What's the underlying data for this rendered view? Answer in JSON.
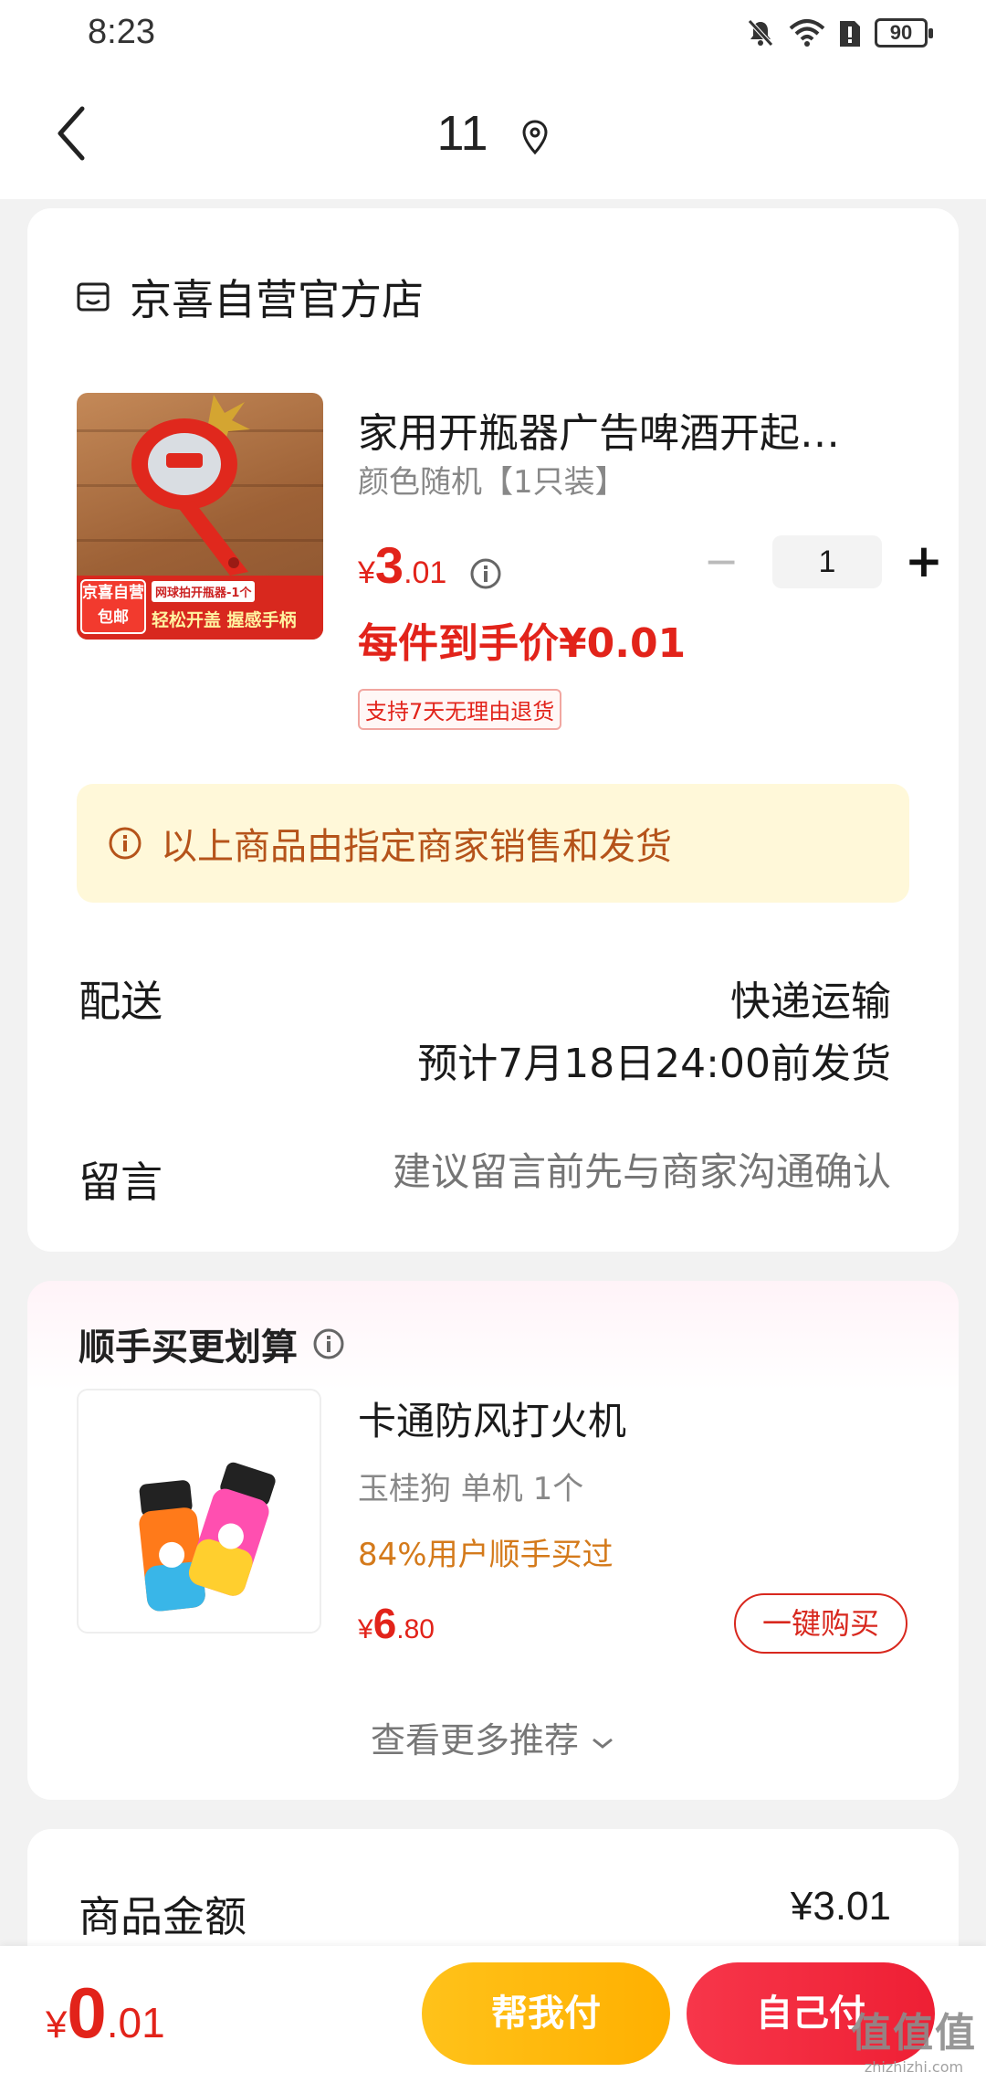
{
  "status_bar": {
    "time": "8:23",
    "battery": "90"
  },
  "nav": {
    "title": "11"
  },
  "shop": {
    "name": "京喜自营官方店"
  },
  "product": {
    "title": "家用开瓶器广告啤酒开起…",
    "spec": "颜色随机【1只装】",
    "price_currency": "¥",
    "price_int": "3",
    "price_dec": ".01",
    "quantity": "1",
    "final_price": "每件到手价¥0.01",
    "return_tag": "支持7天无理由退货",
    "image": {
      "badge": "京喜自营\n包邮",
      "label_small": "网球拍开瓶器-1个",
      "tag": "轻松开盖 握感手柄"
    }
  },
  "notice": {
    "text": "以上商品由指定商家销售和发货"
  },
  "delivery": {
    "label": "配送",
    "method": "快递运输",
    "eta": "预计7月18日24:00前发货"
  },
  "message": {
    "label": "留言",
    "placeholder": "建议留言前先与商家沟通确认"
  },
  "recommend": {
    "section_title": "顺手买更划算",
    "item": {
      "title": "卡通防风打火机",
      "spec": "玉桂狗 单机 1个",
      "tip": "84%用户顺手买过",
      "price_currency": "¥",
      "price_int": "6",
      "price_dec": ".80",
      "buy_label": "一键购买"
    },
    "more_label": "查看更多推荐"
  },
  "summary": {
    "label": "商品金额",
    "value": "¥3.01"
  },
  "bottom": {
    "total_currency": "¥",
    "total_int": "0",
    "total_dec": ".01",
    "help_pay": "帮我付",
    "self_pay": "自己付"
  },
  "watermark": {
    "big": "值值值",
    "small": "zhizhizhi.com"
  },
  "colors": {
    "price_red": "#e2231a",
    "notice_bg": "#fff8d9",
    "help_btn": "#ffb000",
    "self_btn": "#ee1f34"
  }
}
